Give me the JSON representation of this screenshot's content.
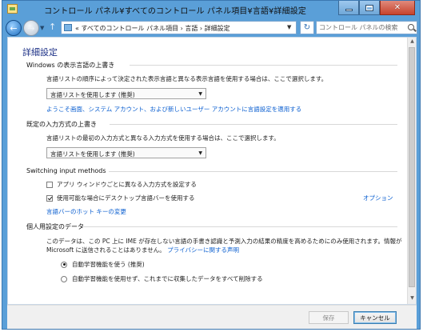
{
  "window": {
    "title": "コントロール パネル¥すべてのコントロール パネル項目¥言語¥詳細設定",
    "buttons": {
      "minimize": "",
      "maximize": "",
      "close": "✕"
    }
  },
  "nav": {
    "back_glyph": "←",
    "forward_glyph": "→",
    "up_glyph": "↑",
    "address": "«  すべてのコントロール パネル項目  ›  言語  ›  詳細設定",
    "search_placeholder": "コントロール パネルの検索"
  },
  "page": {
    "title": "詳細設定",
    "display_language": {
      "heading": "Windows の表示言語の上書き",
      "description": "言語リストの順序によって決定された表示言語と異なる表示言語を使用する場合は、ここで選択します。",
      "dropdown_value": "言語リストを使用します (推奨)",
      "link": "ようこそ画面、システム アカウント、および新しいユーザー アカウントに言語設定を適用する"
    },
    "input_method": {
      "heading": "既定の入力方式の上書き",
      "description": "言語リストの最初の入力方式と異なる入力方式を使用する場合は、ここで選択します。",
      "dropdown_value": "言語リストを使用します (推奨)"
    },
    "switching": {
      "heading": "Switching input methods",
      "checkbox1_label": "アプリ ウィンドウごとに異なる入力方式を設定する",
      "checkbox1_checked": false,
      "checkbox2_label": "使用可能な場合にデスクトップ言語バーを使用する",
      "checkbox2_checked": true,
      "options_link": "オプション",
      "hotkey_link": "言語バーのホット キーの変更"
    },
    "personalization": {
      "heading": "個人用設定のデータ",
      "description_line1": "このデータは、この PC 上に IME が存在しない言語の手書き認識と予測入力の結果の精度を高めるためにのみ使用されます。情報が",
      "description_line2": "Microsoft に送信されることはありません。",
      "privacy_link": "プライバシーに関する声明",
      "radio1_label": "自動学習機能を使う (推奨)",
      "radio1_checked": true,
      "radio2_label": "自動学習機能を使用せず、これまでに収集したデータをすべて削除する",
      "radio2_checked": false
    }
  },
  "footer": {
    "save_label": "保存",
    "cancel_label": "キャンセル"
  }
}
